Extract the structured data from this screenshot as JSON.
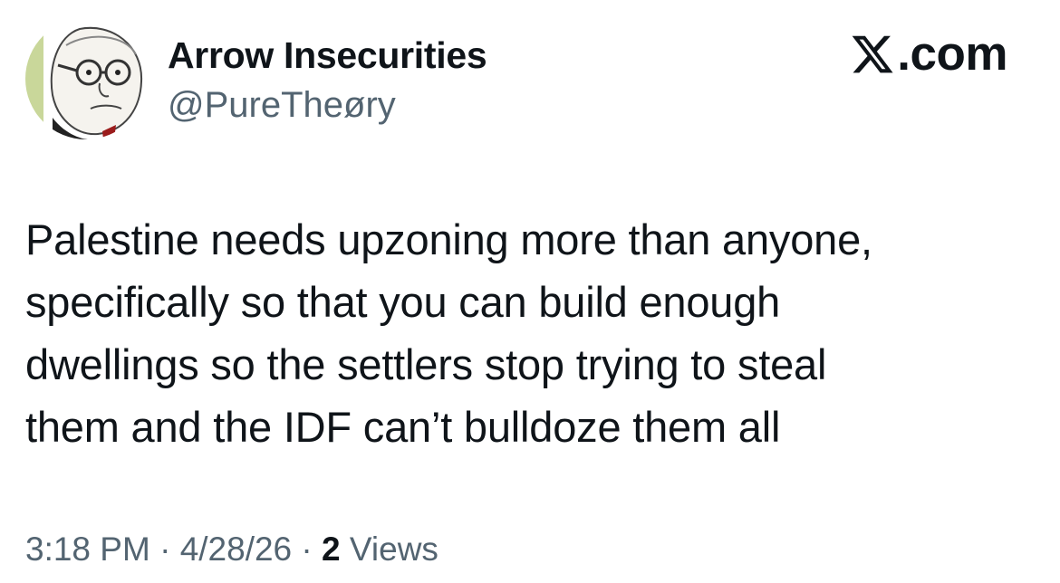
{
  "author": {
    "display_name": "Arrow Insecurities",
    "handle": "@PureTheøry",
    "avatar_icon": "wojak-glasses-avatar-icon"
  },
  "brand": {
    "icon": "x-logo-icon",
    "text": ".com"
  },
  "tweet": {
    "lines": [
      "Palestine needs upzoning more than anyone,",
      "specifically so that you can build enough",
      "dwellings so the settlers stop trying to steal",
      "them and the IDF can’t bulldoze them all"
    ]
  },
  "meta": {
    "time": "3:18 PM",
    "separator": "·",
    "date": "4/28/26",
    "views_count": "2",
    "views_label": "Views"
  },
  "colors": {
    "text": "#0f1419",
    "secondary": "#536471",
    "background": "#ffffff"
  }
}
